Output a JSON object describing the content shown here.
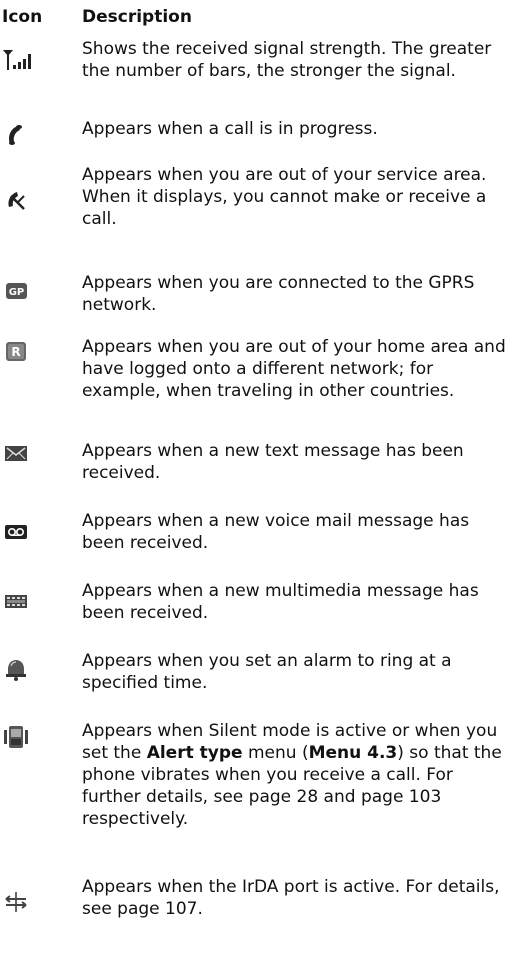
{
  "header": {
    "icon_col": "Icon",
    "desc_col": "Description"
  },
  "rows": [
    {
      "icon": "signal-strength-icon",
      "parts": [
        "Shows the received signal strength. The greater the number of bars, the stronger the signal."
      ]
    },
    {
      "icon": "call-in-progress-icon",
      "parts": [
        "Appears when a call is in progress."
      ]
    },
    {
      "icon": "no-service-icon",
      "parts": [
        "Appears when you are out of your service area. When it displays, you cannot make or receive a call."
      ]
    },
    {
      "icon": "gprs-icon",
      "parts": [
        "Appears when you are connected to the GPRS network."
      ]
    },
    {
      "icon": "roaming-icon",
      "parts": [
        "Appears when you are out of your home area and have logged onto a different network; for example, when traveling in other countries."
      ]
    },
    {
      "icon": "text-message-icon",
      "parts": [
        "Appears when a new text message has been received."
      ]
    },
    {
      "icon": "voice-mail-icon",
      "parts": [
        "Appears when a new voice mail message has been received."
      ]
    },
    {
      "icon": "multimedia-message-icon",
      "parts": [
        "Appears when a new multimedia message has been received."
      ]
    },
    {
      "icon": "alarm-icon",
      "parts": [
        "Appears when you set an alarm to ring at a specified time."
      ]
    },
    {
      "icon": "silent-vibrate-icon",
      "parts": [
        "Appears when Silent mode is active or when you set the ",
        "Alert type",
        " menu (",
        "Menu 4.3",
        ") so that the phone vibrates when you receive a call. For further details, see page 28 and page 103 respectively."
      ]
    },
    {
      "icon": "irda-icon",
      "parts": [
        "Appears when the IrDA port is active. For details, see page 107."
      ]
    }
  ]
}
